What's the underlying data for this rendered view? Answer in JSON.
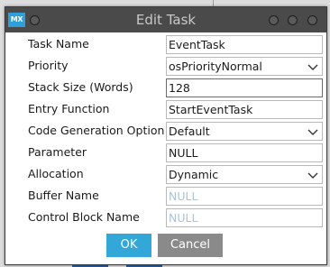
{
  "window": {
    "title": "Edit Task",
    "logo_text": "MX"
  },
  "fields": [
    {
      "label": "Task Name",
      "value": "EventTask",
      "type": "text"
    },
    {
      "label": "Priority",
      "value": "osPriorityNormal",
      "type": "select"
    },
    {
      "label": "Stack Size (Words)",
      "value": "128",
      "type": "text-focused"
    },
    {
      "label": "Entry Function",
      "value": "StartEventTask",
      "type": "text"
    },
    {
      "label": "Code Generation Option",
      "value": "Default",
      "type": "select"
    },
    {
      "label": "Parameter",
      "value": "NULL",
      "type": "text"
    },
    {
      "label": "Allocation",
      "value": "Dynamic",
      "type": "select"
    },
    {
      "label": "Buffer Name",
      "value": "NULL",
      "type": "disabled"
    },
    {
      "label": "Control Block Name",
      "value": "NULL",
      "type": "disabled"
    }
  ],
  "buttons": {
    "ok_label": "OK",
    "cancel_label": "Cancel"
  },
  "colors": {
    "accent": "#34a7d9",
    "titlebar": "#4a4a4a",
    "cancel": "#8a8a8a",
    "disabled_text": "#a9c4d8"
  },
  "icons": {
    "logo": "mx-logo-icon",
    "dropdown": "chevron-down-icon"
  }
}
